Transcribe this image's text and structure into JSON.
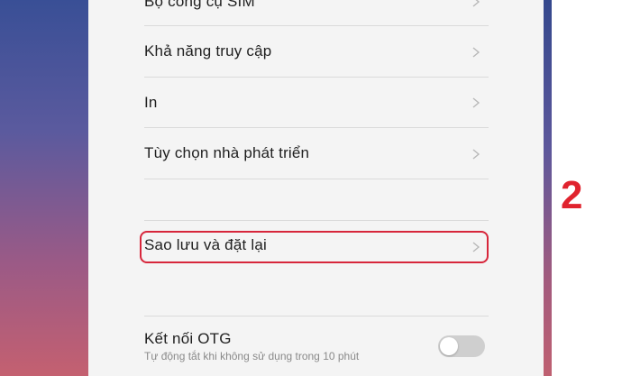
{
  "settings": {
    "items": [
      {
        "label": "Bộ công cụ SIM"
      },
      {
        "label": "Khả năng truy cập"
      },
      {
        "label": "In"
      },
      {
        "label": "Tùy chọn nhà phát triển"
      },
      {
        "label": "Sao lưu và đặt lại"
      }
    ],
    "otg": {
      "label": "Kết nối OTG",
      "subtitle": "Tự động tắt khi không sử dụng trong 10 phút",
      "enabled": false
    }
  },
  "annotation": {
    "step_number": "2",
    "highlight_color": "#d7263b",
    "number_color": "#e0232e"
  },
  "icons": {
    "chevron": "chevron-right-icon"
  }
}
